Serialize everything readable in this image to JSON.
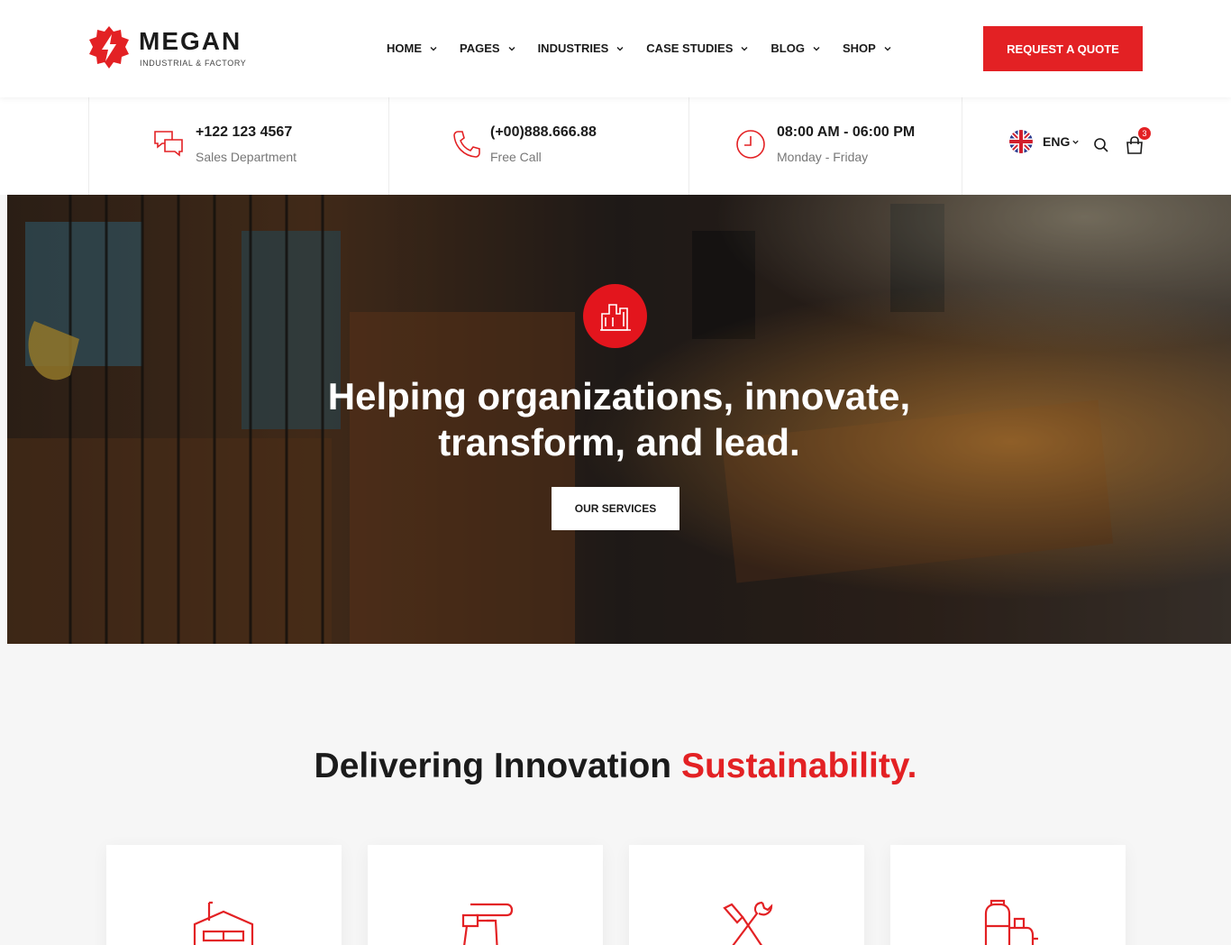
{
  "brand": {
    "name": "MEGAN",
    "tagline": "INDUSTRIAL & FACTORY"
  },
  "nav": [
    {
      "label": "HOME"
    },
    {
      "label": "PAGES"
    },
    {
      "label": "INDUSTRIES"
    },
    {
      "label": "CASE STUDIES"
    },
    {
      "label": "BLOG"
    },
    {
      "label": "SHOP"
    }
  ],
  "header": {
    "cta_label": "REQUEST A QUOTE"
  },
  "info": [
    {
      "title": "+122 123 4567",
      "sub": "Sales Department",
      "icon": "chat-bubbles-icon"
    },
    {
      "title": "(+00)888.666.88",
      "sub": "Free Call",
      "icon": "phone-icon"
    },
    {
      "title": "08:00 AM - 06:00 PM",
      "sub": "Monday - Friday",
      "icon": "clock-icon"
    }
  ],
  "utility": {
    "language": "ENG",
    "cart_count": "3"
  },
  "hero": {
    "title": "Helping organizations, innovate, transform, and lead.",
    "button_label": "OUR SERVICES"
  },
  "section": {
    "title_main": "Delivering Innovation ",
    "title_accent": "Sustainability."
  },
  "cards": [
    {
      "icon": "factory-building-icon"
    },
    {
      "icon": "pipeline-icon"
    },
    {
      "icon": "tools-icon"
    },
    {
      "icon": "refinery-tanks-icon"
    }
  ],
  "colors": {
    "accent": "#e32124",
    "text": "#1b1b1b",
    "muted": "#777777",
    "background": "#f6f6f6"
  }
}
